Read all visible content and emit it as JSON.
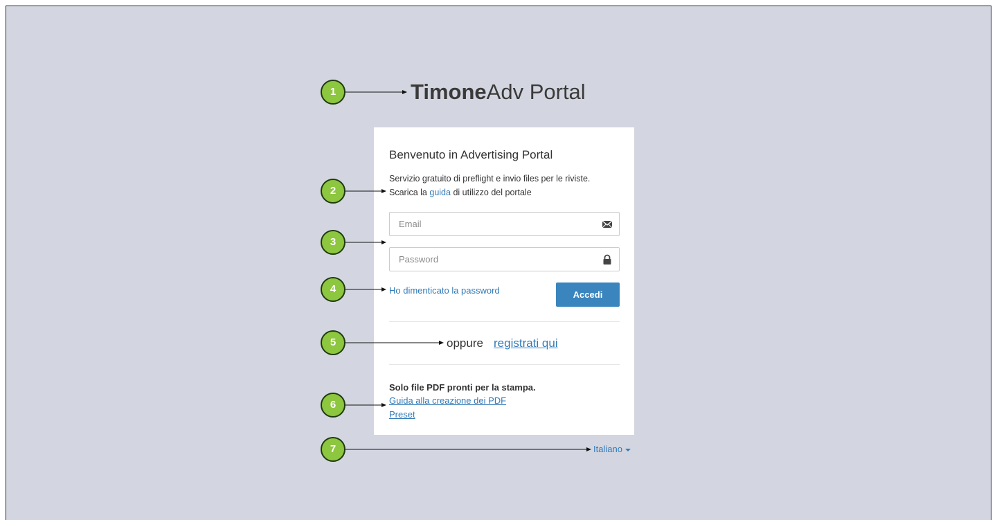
{
  "logo": {
    "bold": "Timone",
    "light": "Adv Portal"
  },
  "card": {
    "title": "Benvenuto in Advertising Portal",
    "desc_line1": "Servizio gratuito di preflight e invio files per le riviste.",
    "desc_line2_prefix": "Scarica la",
    "desc_line2_link": "guida",
    "desc_line2_suffix": "di utilizzo del portale",
    "email_placeholder": "Email",
    "password_placeholder": "Password",
    "forgot_label": "Ho dimenticato la password",
    "login_label": "Accedi",
    "or_label": "oppure",
    "register_label": "registrati qui",
    "pdf_heading": "Solo file PDF pronti per la stampa.",
    "pdf_guide_label": "Guida alla creazione dei PDF",
    "preset_label": "Preset"
  },
  "language": {
    "selected": "Italiano"
  },
  "annotations": [
    "1",
    "2",
    "3",
    "4",
    "5",
    "6",
    "7"
  ],
  "colors": {
    "background": "#d3d6e0",
    "accent": "#3a85bd",
    "link": "#337ab7",
    "badge": "#8dc63f"
  },
  "icons": {
    "email": "envelope-icon",
    "password": "lock-icon",
    "language": "caret-down-icon"
  }
}
